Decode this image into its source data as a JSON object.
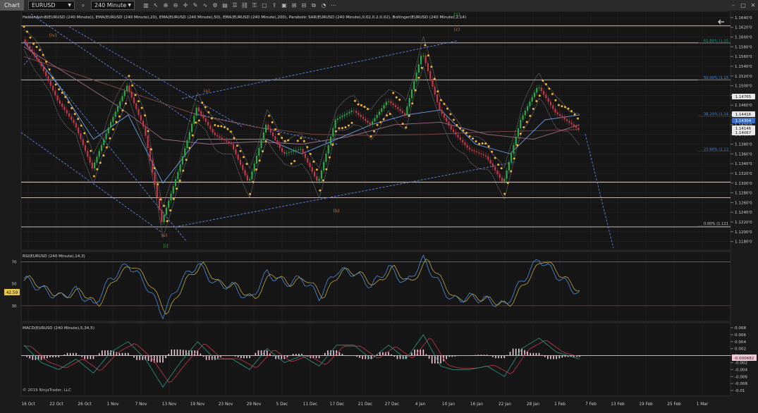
{
  "toolbar": {
    "tab_label": "Chart",
    "instrument": "EURUSD",
    "timeframe": "240 Minute"
  },
  "chart_data": [
    {
      "type": "line",
      "panel": "price",
      "title": "HeikenAshi8(EURUSD (240 Minute)), EMA(EURUSD (240 Minute),20), EMA(EURUSD (240 Minute),50), EMA(EURUSD (240 Minute),200), Parabolic SAR(EURUSD (240 Minute),0.02,0.2,0.02), Bollinger(EURUSD (240 Minute),2,14)",
      "ylim": [
        1.1165,
        1.165
      ],
      "y_ticks": [
        "1.1640'0",
        "1.1620'0",
        "1.1600'0",
        "1.1580'0",
        "1.1560'0",
        "1.1540'0",
        "1.1520'0",
        "1.1500'0",
        "1.1480'0",
        "1.1460'0",
        "1.1440'0",
        "1.1420'0",
        "1.1400'0",
        "1.1380'0",
        "1.1360'0",
        "1.1340'0",
        "1.1320'0",
        "1.1300'0",
        "1.1280'0",
        "1.1260'0",
        "1.1240'0",
        "1.1220'0",
        "1.1200'0",
        "1.1180'0"
      ],
      "series": [
        {
          "name": "HeikenAshi8(EURUSD (240 Minute))",
          "x": [
            0,
            3,
            6,
            9,
            12,
            15,
            18,
            21,
            24,
            27,
            30,
            33,
            36,
            39,
            42,
            45,
            48,
            51,
            54,
            57,
            60,
            63,
            66,
            69,
            72,
            74,
            77,
            80,
            83,
            86,
            89,
            92,
            96
          ],
          "values": [
            1.1595,
            1.1545,
            1.147,
            1.142,
            1.133,
            1.142,
            1.15,
            1.141,
            1.122,
            1.133,
            1.1455,
            1.14,
            1.138,
            1.13,
            1.142,
            1.136,
            1.137,
            1.13,
            1.143,
            1.145,
            1.142,
            1.147,
            1.144,
            1.157,
            1.145,
            1.141,
            1.137,
            1.1355,
            1.13,
            1.143,
            1.15,
            1.1445,
            1.141
          ]
        },
        {
          "name": "EMA(EURUSD (240 Minute),20)",
          "x": [
            0,
            6,
            12,
            18,
            24,
            30,
            36,
            42,
            48,
            54,
            60,
            66,
            72,
            78,
            84,
            90,
            96
          ],
          "values": [
            1.159,
            1.15,
            1.139,
            1.144,
            1.13,
            1.139,
            1.139,
            1.139,
            1.136,
            1.139,
            1.142,
            1.144,
            1.145,
            1.138,
            1.136,
            1.143,
            1.144
          ]
        },
        {
          "name": "EMA(EURUSD (240 Minute),50)",
          "x": [
            0,
            8,
            16,
            24,
            32,
            40,
            48,
            56,
            64,
            72,
            80,
            88,
            96
          ],
          "values": [
            1.158,
            1.152,
            1.146,
            1.139,
            1.138,
            1.1385,
            1.138,
            1.1395,
            1.142,
            1.1425,
            1.14,
            1.139,
            1.142
          ]
        },
        {
          "name": "EMA(EURUSD (240 Minute),200)",
          "x": [
            0,
            10,
            20,
            30,
            40,
            50,
            60,
            70,
            80,
            90,
            96
          ],
          "values": [
            1.156,
            1.152,
            1.148,
            1.144,
            1.1415,
            1.14,
            1.1398,
            1.14,
            1.1405,
            1.1408,
            1.141
          ]
        }
      ],
      "horizontal_levels": [
        1.1623,
        1.1588,
        1.1512,
        1.1302,
        1.127,
        1.121
      ],
      "fibonacci": [
        {
          "label": "61.80% (1.15",
          "value": 1.1588
        },
        {
          "label": "50.00% (1.15",
          "value": 1.1512
        },
        {
          "label": "38.20% (1.14",
          "value": 1.1437
        },
        {
          "label": "23.60% (1.13",
          "value": 1.1365
        },
        {
          "label": "0.00% (1.121",
          "value": 1.1212
        }
      ],
      "price_labels": [
        {
          "text": "1.14765",
          "value": 1.14765,
          "color": "#e8e8e8",
          "text_color": "#111111"
        },
        {
          "text": "1.14416",
          "value": 1.14416,
          "color": "#e8e8e8",
          "text_color": "#111111"
        },
        {
          "text": "1.14304",
          "value": 1.14304,
          "color": "#3a6ec8",
          "text_color": "#ffffff"
        },
        {
          "text": "1.14146",
          "value": 1.14146,
          "color": "#e8e8e8",
          "text_color": "#111111"
        },
        {
          "text": "1.14067",
          "value": 1.14067,
          "color": "#e8e8e8",
          "text_color": "#111111"
        }
      ],
      "wave_labels": [
        {
          "text": "(iv)",
          "color": "#c8743a"
        },
        {
          "text": "(a)",
          "color": "#c8743a"
        },
        {
          "text": "(v)",
          "color": "#c8743a"
        },
        {
          "text": "[i]",
          "color": "#3aa83a"
        },
        {
          "text": "(b)",
          "color": "#c8743a"
        },
        {
          "text": "[ii]",
          "color": "#3aa83a"
        },
        {
          "text": "(c)",
          "color": "#c8743a"
        }
      ],
      "colors": {
        "bull": "#2ea84a",
        "bear": "#c23a4a",
        "sar": "#f2b233",
        "ema20": "#6aa0e8",
        "ema50": "#a06a8a",
        "ema200": "#8a4a4a",
        "level": "#e0d0c8",
        "trend": "#5a86e0"
      }
    },
    {
      "type": "line",
      "panel": "rsi",
      "title": "RSI(EURUSD (240 Minute),14,3)",
      "ylim": [
        17,
        78
      ],
      "y_ticks": [
        "70",
        "50",
        "30"
      ],
      "reference_lines": [
        70,
        30
      ],
      "current_label": "42.59",
      "series": [
        {
          "name": "RSI",
          "x": [
            0,
            3,
            6,
            9,
            12,
            15,
            18,
            21,
            24,
            27,
            30,
            33,
            36,
            39,
            42,
            45,
            48,
            51,
            54,
            57,
            60,
            63,
            66,
            69,
            72,
            74,
            77,
            80,
            83,
            86,
            89,
            92,
            96
          ],
          "values": [
            55,
            45,
            38,
            44,
            30,
            55,
            68,
            50,
            22,
            52,
            68,
            50,
            48,
            35,
            60,
            50,
            55,
            38,
            62,
            60,
            48,
            65,
            50,
            72,
            48,
            35,
            38,
            35,
            30,
            52,
            73,
            58,
            40
          ]
        }
      ]
    },
    {
      "type": "bar",
      "panel": "macd",
      "title": "MACD(EURUSD (240 Minute),5,34,5)",
      "ylim": [
        -0.0112,
        0.009
      ],
      "y_ticks": [
        "0.008",
        "0.006",
        "0.004",
        "0.002",
        "0",
        "-0.002",
        "-0.004",
        "-0.006",
        "-0.008",
        "-0.01"
      ],
      "current_label": "-0.000682",
      "series": [
        {
          "name": "MACD",
          "x": [
            0,
            3,
            6,
            9,
            12,
            15,
            18,
            21,
            24,
            27,
            30,
            33,
            36,
            39,
            42,
            45,
            48,
            51,
            54,
            57,
            60,
            63,
            66,
            69,
            72,
            74,
            77,
            80,
            83,
            86,
            89,
            92,
            96
          ],
          "values": [
            0.003,
            -0.002,
            -0.004,
            -0.001,
            -0.005,
            0.001,
            0.004,
            -0.001,
            -0.009,
            -0.002,
            0.004,
            -0.001,
            -0.001,
            -0.004,
            0.002,
            -0.002,
            0.0,
            -0.003,
            0.003,
            0.003,
            -0.001,
            0.003,
            -0.001,
            0.006,
            -0.003,
            -0.004,
            -0.004,
            -0.003,
            -0.006,
            0.002,
            0.005,
            0.001,
            -0.001
          ]
        }
      ]
    }
  ],
  "x_axis": {
    "ticks": [
      "16 Oct",
      "22 Oct",
      "26 Oct",
      "1 Nov",
      "7 Nov",
      "13 Nov",
      "19 Nov",
      "23 Nov",
      "29 Nov",
      "5 Dec",
      "11 Dec",
      "17 Dec",
      "21 Dec",
      "27 Dec",
      "4 Jan",
      "10 Jan",
      "16 Jan",
      "22 Jan",
      "28 Jan",
      "1 Feb",
      "7 Feb",
      "13 Feb",
      "19 Feb",
      "25 Feb",
      "1 Mar"
    ]
  },
  "copyright": "© 2019 NinjaTrader, LLC"
}
